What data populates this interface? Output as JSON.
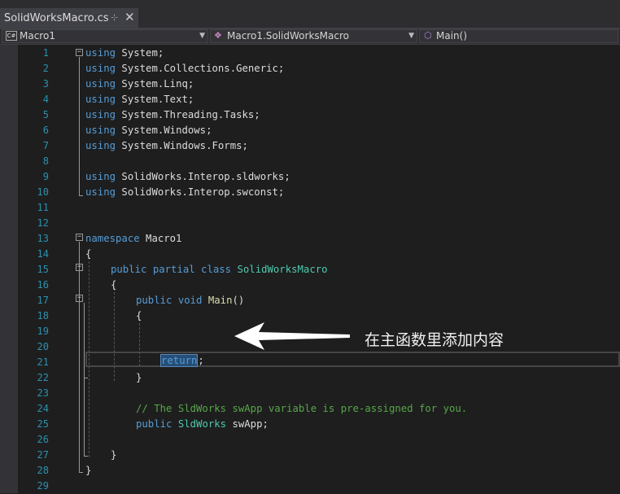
{
  "tab": {
    "title": "SolidWorksMacro.cs",
    "pin_icon": "⊹",
    "close_icon": "✕"
  },
  "nav": {
    "project": {
      "icon_text": "C#",
      "label": "Macro1"
    },
    "class": {
      "label": "Macro1.SolidWorksMacro"
    },
    "member": {
      "label": "Main()"
    }
  },
  "annotation": {
    "text": "在主函数里添加内容"
  },
  "lines": {
    "l1": {
      "kw": "using",
      "rest": " System;"
    },
    "l2": {
      "kw": "using",
      "rest": " System.Collections.Generic;"
    },
    "l3": {
      "kw": "using",
      "rest": " System.Linq;"
    },
    "l4": {
      "kw": "using",
      "rest": " System.Text;"
    },
    "l5": {
      "kw": "using",
      "rest": " System.Threading.Tasks;"
    },
    "l6": {
      "kw": "using",
      "rest": " System.Windows;"
    },
    "l7": {
      "kw": "using",
      "rest": " System.Windows.Forms;"
    },
    "l9": {
      "kw": "using",
      "rest": " SolidWorks.Interop.sldworks;"
    },
    "l10": {
      "kw": "using",
      "rest": " SolidWorks.Interop.swconst;"
    },
    "l13": {
      "kw": "namespace",
      "rest": " Macro1"
    },
    "l14": {
      "text": "{"
    },
    "l15": {
      "kw1": "public",
      "kw2": " partial",
      "kw3": " class",
      "ty": " SolidWorksMacro"
    },
    "l16": {
      "text": "{"
    },
    "l17": {
      "kw1": "public",
      "kw2": " void",
      "fn": " Main",
      "rest": "()"
    },
    "l18": {
      "text": "{"
    },
    "l21": {
      "kw": "return",
      "rest": ";"
    },
    "l22": {
      "text": "}"
    },
    "l24": {
      "comment": "// The SldWorks swApp variable is pre-assigned for you."
    },
    "l25": {
      "kw": "public",
      "ty": " SldWorks",
      "rest": " swApp;"
    },
    "l27": {
      "text": "}"
    },
    "l28": {
      "text": "}"
    }
  },
  "line_numbers": [
    "1",
    "2",
    "3",
    "4",
    "5",
    "6",
    "7",
    "8",
    "9",
    "10",
    "11",
    "12",
    "13",
    "14",
    "15",
    "16",
    "17",
    "18",
    "19",
    "20",
    "21",
    "22",
    "23",
    "24",
    "25",
    "26",
    "27",
    "28",
    "29"
  ],
  "colors": {
    "keyword": "#569cd6",
    "type": "#4ec9b0",
    "method": "#dcdcaa",
    "comment": "#57a64a",
    "line_number": "#2b91af",
    "background": "#1e1e1e"
  }
}
